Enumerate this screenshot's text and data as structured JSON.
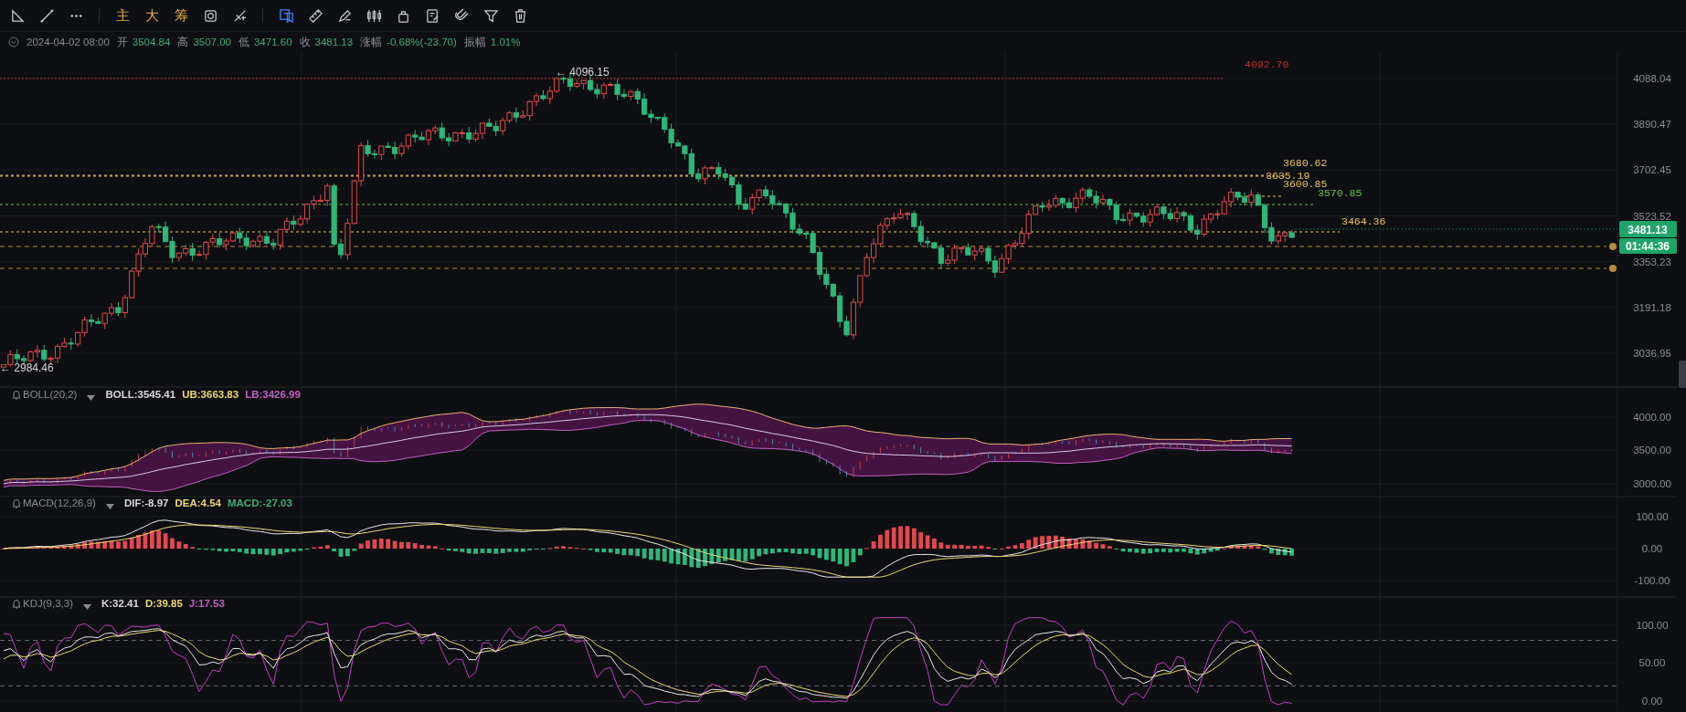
{
  "toolbar": {
    "groups": [
      [
        {
          "kind": "angle",
          "selected": false
        },
        {
          "kind": "line",
          "selected": false
        },
        {
          "kind": "more",
          "selected": false
        }
      ],
      [
        {
          "kind": "text",
          "label": "主",
          "selected": false
        },
        {
          "kind": "text",
          "label": "大",
          "selected": false
        },
        {
          "kind": "text",
          "label": "筹",
          "selected": false
        },
        {
          "kind": "sync",
          "selected": false
        },
        {
          "kind": "cross",
          "selected": false
        }
      ],
      [
        {
          "kind": "layers",
          "selected": true
        },
        {
          "kind": "ruler",
          "selected": false
        },
        {
          "kind": "pen",
          "selected": false
        },
        {
          "kind": "candles",
          "selected": false
        },
        {
          "kind": "lock",
          "selected": false
        },
        {
          "kind": "note",
          "selected": false
        },
        {
          "kind": "magnet",
          "selected": false
        },
        {
          "kind": "filter",
          "selected": false
        },
        {
          "kind": "trash",
          "selected": false
        }
      ]
    ]
  },
  "info": {
    "datetime": "2024-04-02 08:00",
    "fields": [
      {
        "label": "开",
        "value": "3504.84"
      },
      {
        "label": "高",
        "value": "3507.00"
      },
      {
        "label": "低",
        "value": "3471.60"
      },
      {
        "label": "收",
        "value": "3481.13"
      },
      {
        "label": "涨幅",
        "value": "-0.68%(-23.70)"
      },
      {
        "label": "振幅",
        "value": "1.01%"
      }
    ]
  },
  "main_chart": {
    "axis_labels": [
      "4088.04",
      "3890.47",
      "3702.45",
      "3523.52",
      "3353.23",
      "3191.18",
      "3036.95"
    ],
    "high_marker": "← 4096.15",
    "low_marker": "← 2984.46",
    "price_lines": [
      {
        "label": "4092.70",
        "color": "#c0302f"
      },
      {
        "label": "3680.62",
        "color": "#e8c45a"
      },
      {
        "label": "3635.19",
        "color": "#e8c45a"
      },
      {
        "label": "3600.85",
        "color": "#e8c45a"
      },
      {
        "label": "3570.85",
        "color": "#6cc04a"
      },
      {
        "label": "3464.36",
        "color": "#e8c45a"
      }
    ],
    "alerts": [
      {
        "kind": "bell"
      },
      {
        "kind": "bell"
      }
    ],
    "last_price": "3481.13",
    "countdown": "01:44:36"
  },
  "indicators": [
    {
      "kind": "boll",
      "name": "BOLL(20,2)",
      "values": [
        {
          "text": "BOLL:3545.41",
          "color": "#d8d8d8"
        },
        {
          "text": "UB:3663.83",
          "color": "#e8d870"
        },
        {
          "text": "LB:3426.99",
          "color": "#c060c0"
        }
      ],
      "axis_labels": [
        "4000.00",
        "3500.00",
        "3000.00"
      ]
    },
    {
      "kind": "macd",
      "name": "MACD(12,26,9)",
      "values": [
        {
          "text": "DIF:-8.97",
          "color": "#d8d8d8"
        },
        {
          "text": "DEA:4.54",
          "color": "#e8d870"
        },
        {
          "text": "MACD:-27.03",
          "color": "#3fae74"
        }
      ],
      "axis_labels": [
        "100.00",
        "0.00",
        "-100.00"
      ]
    },
    {
      "kind": "kdj",
      "name": "KDJ(9,3,3)",
      "values": [
        {
          "text": "K:32.41",
          "color": "#d8d8d8"
        },
        {
          "text": "D:39.85",
          "color": "#e8d870"
        },
        {
          "text": "J:17.53",
          "color": "#c060c0"
        }
      ],
      "axis_labels": [
        "100.00",
        "50.00",
        "0.00"
      ]
    }
  ]
}
